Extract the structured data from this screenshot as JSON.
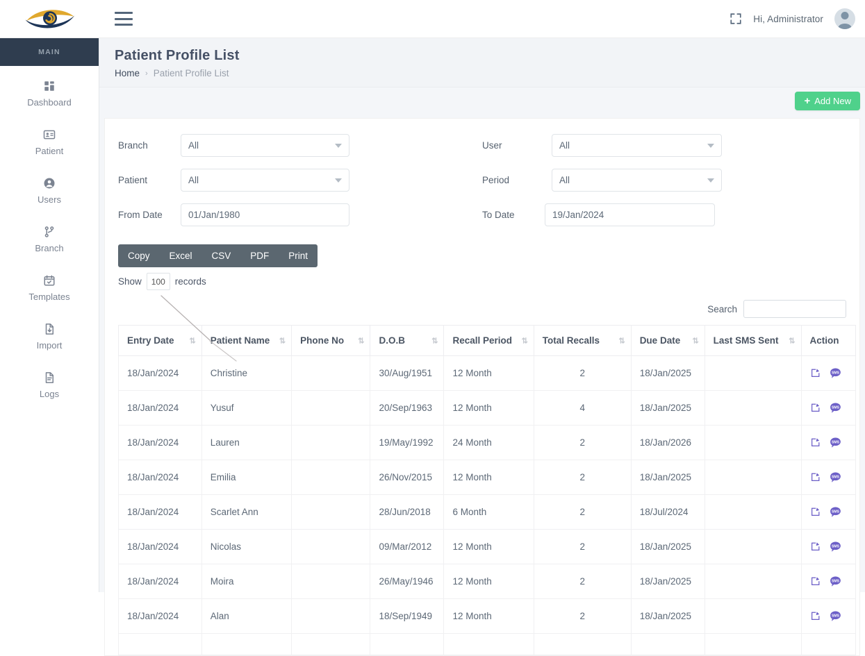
{
  "topbar": {
    "logo_alt": "eye-logo",
    "greeting": "Hi, Administrator",
    "fullscreen_icon": "fullscreen-icon",
    "menu_icon": "hamburger-icon",
    "avatar_icon": "user-avatar"
  },
  "sidebar": {
    "heading": "MAIN",
    "items": [
      {
        "label": "Dashboard",
        "icon": "dashboard-icon"
      },
      {
        "label": "Patient",
        "icon": "patient-card-icon"
      },
      {
        "label": "Users",
        "icon": "user-circle-icon"
      },
      {
        "label": "Branch",
        "icon": "branch-fork-icon"
      },
      {
        "label": "Templates",
        "icon": "calendar-check-icon"
      },
      {
        "label": "Import",
        "icon": "file-import-icon"
      },
      {
        "label": "Logs",
        "icon": "file-lines-icon"
      }
    ]
  },
  "page": {
    "title": "Patient Profile List",
    "breadcrumb_home": "Home",
    "breadcrumb_sep": "›",
    "breadcrumb_current": "Patient Profile List",
    "add_new_label": "Add New",
    "add_new_plus": "+"
  },
  "filters": {
    "branch": {
      "label": "Branch",
      "value": "All"
    },
    "patient": {
      "label": "Patient",
      "value": "All"
    },
    "from_date": {
      "label": "From Date",
      "value": "01/Jan/1980"
    },
    "user": {
      "label": "User",
      "value": "All"
    },
    "period": {
      "label": "Period",
      "value": "All"
    },
    "to_date": {
      "label": "To Date",
      "value": "19/Jan/2024"
    }
  },
  "export_buttons": [
    "Copy",
    "Excel",
    "CSV",
    "PDF",
    "Print"
  ],
  "show": {
    "prefix": "Show",
    "value": "100",
    "suffix": "records"
  },
  "search": {
    "label": "Search",
    "value": "",
    "placeholder": ""
  },
  "table": {
    "columns": [
      "Entry Date",
      "Patient Name",
      "Phone No",
      "D.O.B",
      "Recall Period",
      "Total Recalls",
      "Due Date",
      "Last SMS Sent",
      "Action"
    ],
    "sort_icon": "⇅",
    "action_icons": [
      "edit-icon",
      "sms-icon"
    ],
    "rows": [
      {
        "entry_date": "18/Jan/2024",
        "name": "Christine",
        "phone": "",
        "dob": "30/Aug/1951",
        "recall": "12 Month",
        "total": "2",
        "due": "18/Jan/2025",
        "last_sms": ""
      },
      {
        "entry_date": "18/Jan/2024",
        "name": "Yusuf",
        "phone": "",
        "dob": "20/Sep/1963",
        "recall": "12 Month",
        "total": "4",
        "due": "18/Jan/2025",
        "last_sms": ""
      },
      {
        "entry_date": "18/Jan/2024",
        "name": "Lauren",
        "phone": "",
        "dob": "19/May/1992",
        "recall": "24 Month",
        "total": "2",
        "due": "18/Jan/2026",
        "last_sms": ""
      },
      {
        "entry_date": "18/Jan/2024",
        "name": "Emilia",
        "phone": "",
        "dob": "26/Nov/2015",
        "recall": "12 Month",
        "total": "2",
        "due": "18/Jan/2025",
        "last_sms": ""
      },
      {
        "entry_date": "18/Jan/2024",
        "name": "Scarlet Ann",
        "phone": "",
        "dob": "28/Jun/2018",
        "recall": "6 Month",
        "total": "2",
        "due": "18/Jul/2024",
        "last_sms": ""
      },
      {
        "entry_date": "18/Jan/2024",
        "name": "Nicolas",
        "phone": "",
        "dob": "09/Mar/2012",
        "recall": "12 Month",
        "total": "2",
        "due": "18/Jan/2025",
        "last_sms": ""
      },
      {
        "entry_date": "18/Jan/2024",
        "name": "Moira",
        "phone": "",
        "dob": "26/May/1946",
        "recall": "12 Month",
        "total": "2",
        "due": "18/Jan/2025",
        "last_sms": ""
      },
      {
        "entry_date": "18/Jan/2024",
        "name": "Alan",
        "phone": "",
        "dob": "18/Sep/1949",
        "recall": "12 Month",
        "total": "2",
        "due": "18/Jan/2025",
        "last_sms": ""
      },
      {
        "entry_date": "",
        "name": "",
        "phone": "",
        "dob": "",
        "recall": "",
        "total": "",
        "due": "",
        "last_sms": ""
      }
    ]
  },
  "colors": {
    "accent_green": "#4fd18b",
    "sidebar_dark": "#2f3d4f",
    "export_bar": "#5b6770",
    "action_purple": "#6c5fc7",
    "logo_gold": "#e0a82e",
    "logo_navy": "#1d3557"
  }
}
